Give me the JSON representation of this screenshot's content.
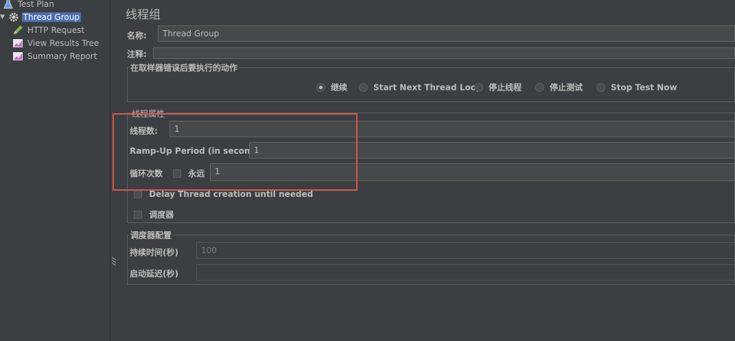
{
  "tree": {
    "items": [
      {
        "label": "Test Plan",
        "icon": "test-plan-icon"
      },
      {
        "label": "Thread Group",
        "icon": "gear-icon",
        "selected": true
      },
      {
        "label": "HTTP Request",
        "icon": "pen-icon"
      },
      {
        "label": "View Results Tree",
        "icon": "chart-icon"
      },
      {
        "label": "Summary Report",
        "icon": "chart-icon"
      }
    ]
  },
  "panel": {
    "title": "线程组",
    "name_label": "名称:",
    "name_value": "Thread Group",
    "comment_label": "注释:",
    "comment_value": "",
    "error_action": {
      "title": "在取样器错误后要执行的动作",
      "options": [
        "继续",
        "Start Next Thread Loop",
        "停止线程",
        "停止测试",
        "Stop Test Now"
      ],
      "selected": "继续"
    },
    "thread_props": {
      "title": "线程属性",
      "threads_label": "线程数:",
      "threads_value": "1",
      "rampup_label": "Ramp-Up Period (in seconds):",
      "rampup_value": "1",
      "loop_label": "循环次数",
      "forever_label": "永远",
      "forever_checked": false,
      "loop_value": "1",
      "delay_label": "Delay Thread creation until needed",
      "delay_checked": false,
      "scheduler_label": "调度器",
      "scheduler_checked": false
    },
    "scheduler": {
      "title": "调度器配置",
      "duration_label": "持续时间(秒)",
      "duration_value": "100",
      "delay_label": "启动延迟(秒)",
      "delay_value": ""
    }
  },
  "colors": {
    "background": "#3c3f41",
    "selection": "#4b6eaf",
    "highlight": "#e0564a"
  }
}
